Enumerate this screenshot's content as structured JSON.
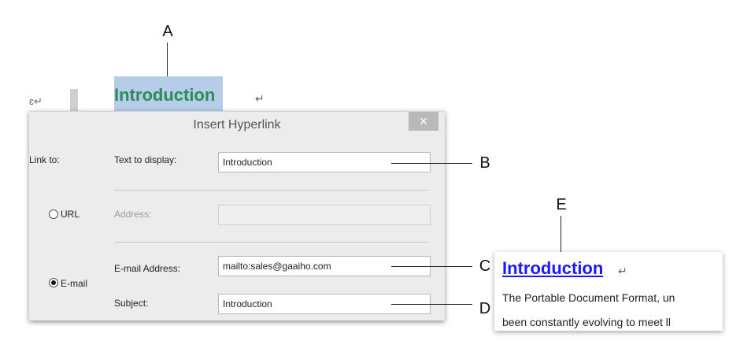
{
  "document": {
    "heading": "Introduction",
    "pilcrow": "↵",
    "left_mark": "ɛ↵"
  },
  "dialog": {
    "title": "Insert Hyperlink",
    "close": "×",
    "link_to_label": "Link to:",
    "text_to_display_label": "Text to display:",
    "text_to_display_value": "Introduction",
    "address_label": "Address:",
    "address_value": "",
    "email_address_label": "E-mail Address:",
    "email_address_value": "mailto:sales@gaaiho.com",
    "subject_label": "Subject:",
    "subject_value": "Introduction",
    "options": [
      {
        "label": "URL",
        "selected": false
      },
      {
        "label": "E-mail",
        "selected": true
      }
    ]
  },
  "callouts": {
    "a": "A",
    "b": "B",
    "c": "C",
    "d": "D",
    "e": "E"
  },
  "result": {
    "link_text": "Introduction",
    "pilcrow": "↵",
    "line1": "The Portable Document Format, un",
    "line2": "been constantly evolving to meet ll"
  },
  "colors": {
    "selection": "#b6cdea",
    "heading_green": "#2e8b57",
    "link_blue": "#1a1aff",
    "dialog_bg": "#ececec"
  }
}
